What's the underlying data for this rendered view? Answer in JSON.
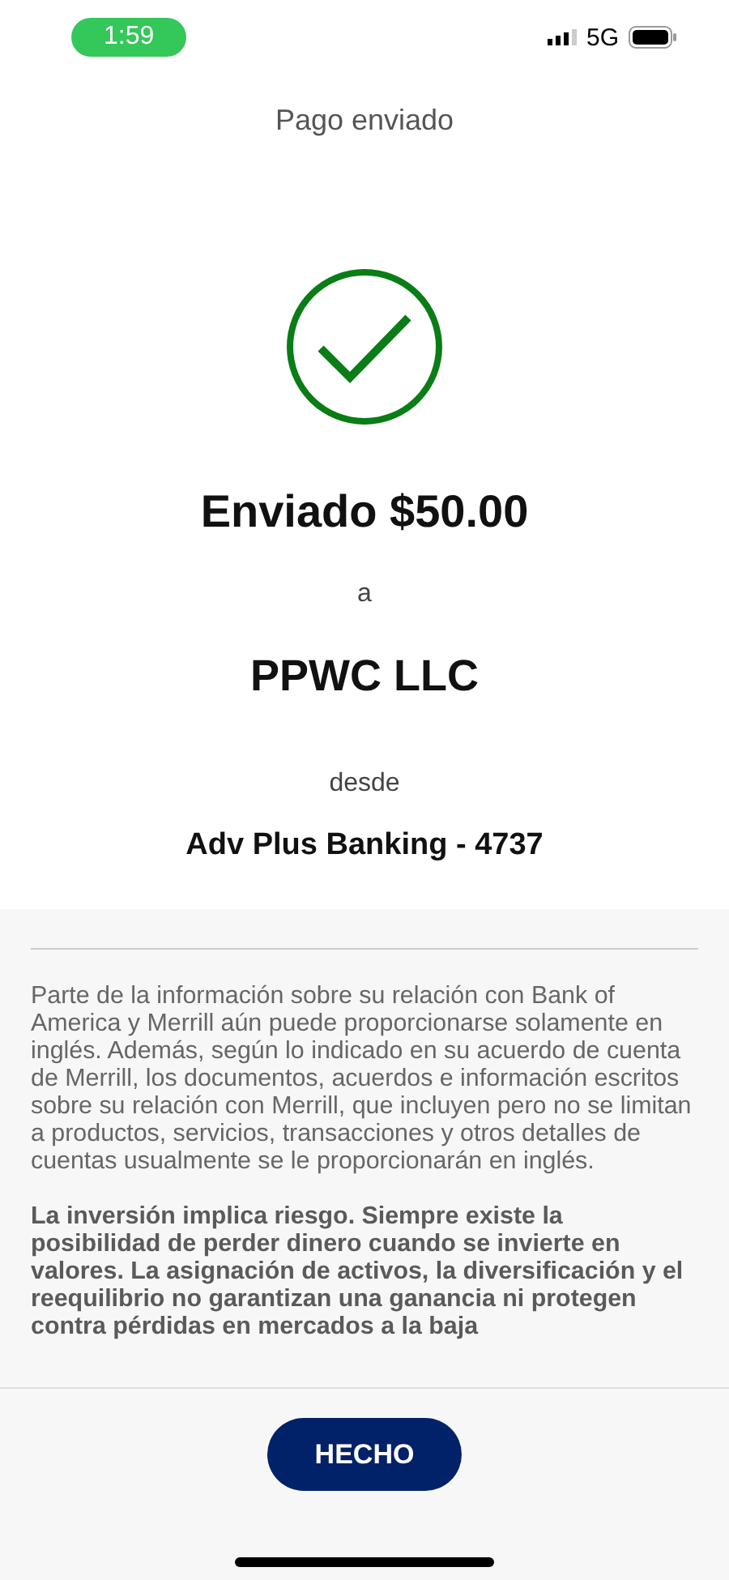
{
  "status_bar": {
    "time": "1:59",
    "network": "5G"
  },
  "title": "Pago enviado",
  "confirmation": {
    "succeeded": true,
    "amount_line": "Enviado $50.00",
    "to_label": "a",
    "recipient": "PPWC LLC",
    "from_label": "desde",
    "account": "Adv Plus Banking - 4737"
  },
  "disclosures": [
    {
      "text": "Parte de la información sobre su relación con Bank of America y Merrill aún puede proporcionarse solamente en inglés. Además, según lo indicado en su acuerdo de cuenta de Merrill, los documentos, acuerdos e información escritos sobre su relación con Merrill, que incluyen pero no se limitan a productos, servicios, transacciones y otros detalles de cuentas usualmente se le proporcionarán en inglés.",
      "bold": false
    },
    {
      "text": "La inversión implica riesgo. Siempre existe la posibilidad de perder dinero cuando se invierte en valores. La asignación de activos, la diversificación y el reequilibrio no garantizan una ganancia ni protegen contra pérdidas en mercados a la baja",
      "bold": true
    }
  ],
  "done_button": "HECHO"
}
